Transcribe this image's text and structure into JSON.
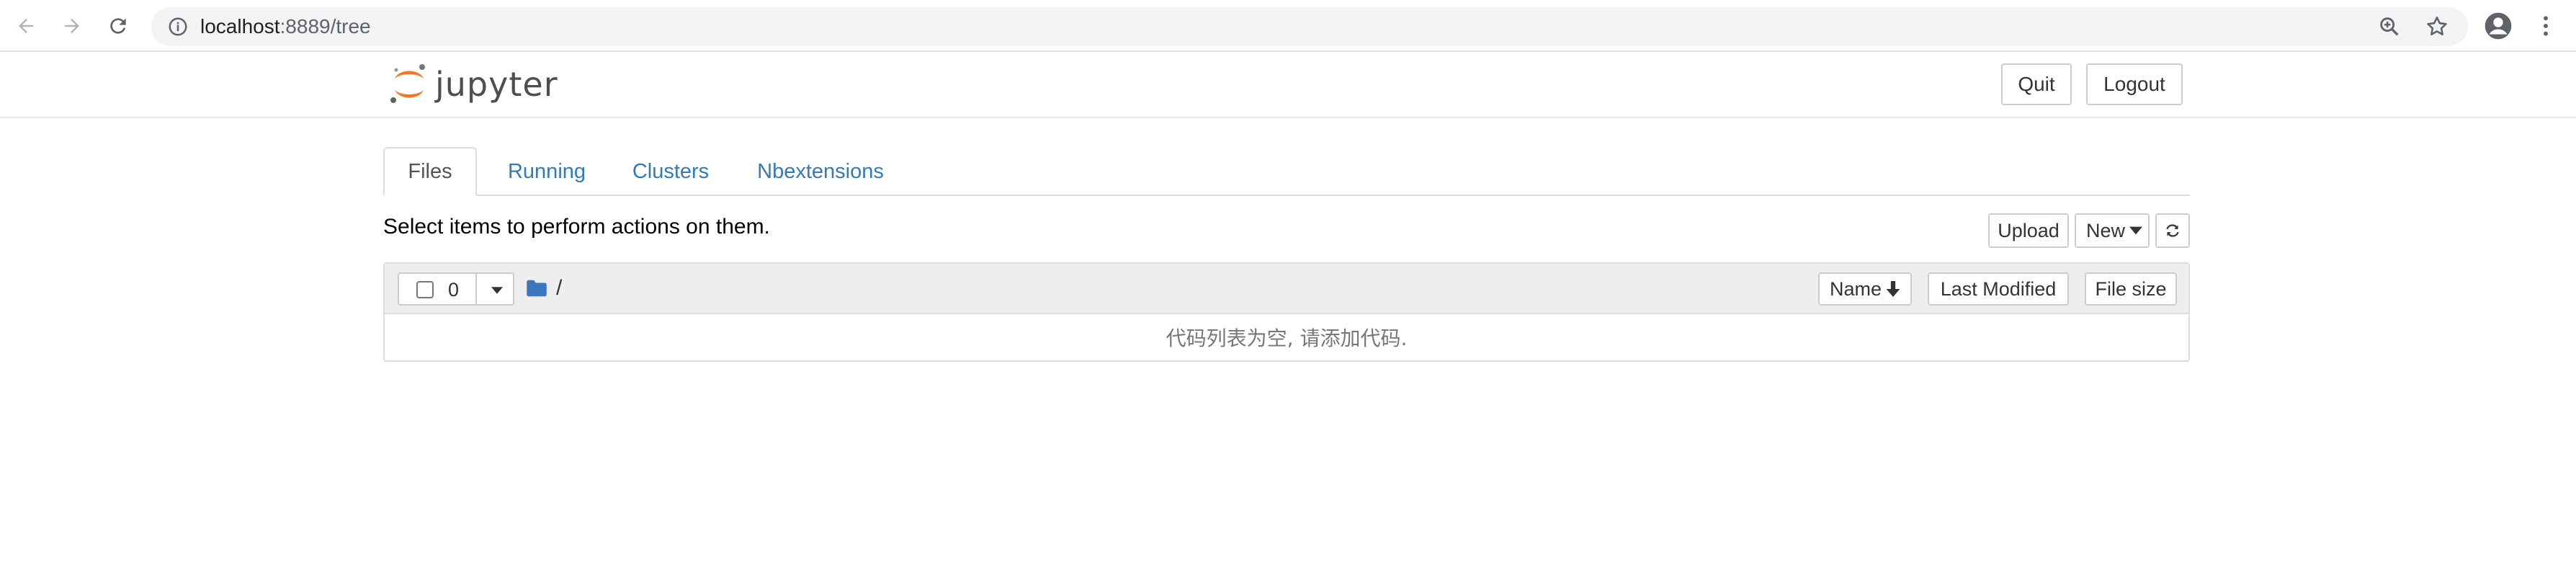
{
  "browser": {
    "url_host": "localhost",
    "url_rest": ":8889/tree",
    "icons": [
      "back-arrow-icon",
      "forward-arrow-icon",
      "reload-icon",
      "info-icon",
      "zoom-icon",
      "star-icon",
      "profile-icon",
      "menu-dots-icon"
    ]
  },
  "header": {
    "logo_text": "jupyter",
    "quit_label": "Quit",
    "logout_label": "Logout"
  },
  "tabs": [
    {
      "label": "Files",
      "active": true
    },
    {
      "label": "Running",
      "active": false
    },
    {
      "label": "Clusters",
      "active": false
    },
    {
      "label": "Nbextensions",
      "active": false
    }
  ],
  "toolbar": {
    "message": "Select items to perform actions on them.",
    "upload_label": "Upload",
    "new_label": "New"
  },
  "list": {
    "selected_count": "0",
    "breadcrumb": "/",
    "col_name": "Name",
    "col_modified": "Last Modified",
    "col_size": "File size",
    "empty_message": "代码列表为空, 请添加代码."
  },
  "colors": {
    "link": "#337ab7",
    "logo_orange": "#f37726",
    "folder": "#3a77bd"
  }
}
